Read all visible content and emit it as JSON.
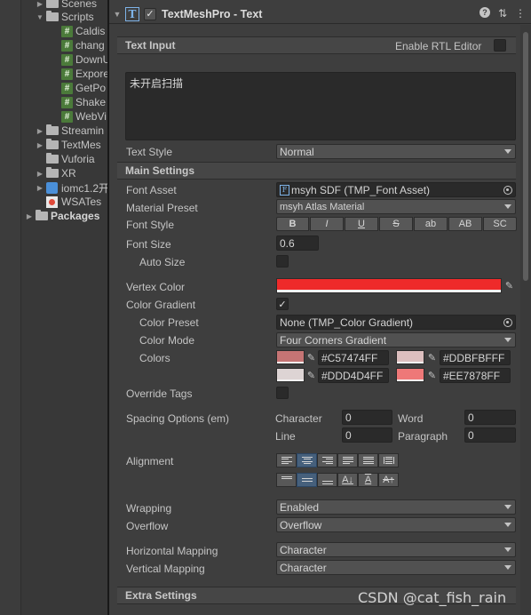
{
  "tree": {
    "items": [
      {
        "label": "Scenes",
        "kind": "folder",
        "arrow": "▶"
      },
      {
        "label": "Scripts",
        "kind": "folder",
        "arrow": "▼"
      },
      {
        "label": "Caldis",
        "kind": "script"
      },
      {
        "label": "chang",
        "kind": "script"
      },
      {
        "label": "DownU",
        "kind": "script"
      },
      {
        "label": "Expore",
        "kind": "script"
      },
      {
        "label": "GetPo",
        "kind": "script"
      },
      {
        "label": "Shake",
        "kind": "script"
      },
      {
        "label": "WebVi",
        "kind": "script"
      },
      {
        "label": "Streamin",
        "kind": "folder",
        "arrow": "▶"
      },
      {
        "label": "TextMes",
        "kind": "folder",
        "arrow": "▶"
      },
      {
        "label": "Vuforia",
        "kind": "folder"
      },
      {
        "label": "XR",
        "kind": "folder",
        "arrow": "▶"
      },
      {
        "label": "iomc1.2开",
        "kind": "package",
        "arrow": "▶"
      },
      {
        "label": "WSATes",
        "kind": "wsa"
      },
      {
        "label": "Packages",
        "kind": "folder",
        "arrow": "▶",
        "bold": true
      }
    ]
  },
  "component": {
    "title": "TextMeshPro - Text",
    "enabled": true,
    "icons": [
      "help-icon",
      "preset-icon",
      "more-icon"
    ]
  },
  "text_input": {
    "header": "Text Input",
    "rtl_label": "Enable RTL Editor",
    "rtl_enabled": false,
    "value": "未开启扫描"
  },
  "text_style": {
    "label": "Text Style",
    "value": "Normal"
  },
  "main_settings": {
    "header": "Main Settings",
    "font_asset": {
      "label": "Font Asset",
      "value": "msyh SDF (TMP_Font Asset)"
    },
    "material_preset": {
      "label": "Material Preset",
      "value": "msyh Atlas Material"
    },
    "font_style": {
      "label": "Font Style",
      "buttons": [
        "B",
        "I",
        "U",
        "S",
        "ab",
        "AB",
        "SC"
      ]
    },
    "font_size": {
      "label": "Font Size",
      "value": "0.6"
    },
    "auto_size": {
      "label": "Auto Size",
      "checked": false
    },
    "vertex_color": {
      "label": "Vertex Color",
      "color": "#EE2A2A"
    },
    "color_gradient": {
      "label": "Color Gradient",
      "checked": true
    },
    "color_preset": {
      "label": "Color Preset",
      "value": "None (TMP_Color Gradient)"
    },
    "color_mode": {
      "label": "Color Mode",
      "value": "Four Corners Gradient"
    },
    "colors": {
      "label": "Colors",
      "items": [
        {
          "hex": "#C57474FF",
          "color": "#C57474"
        },
        {
          "hex": "#DDBFBFFF",
          "color": "#DDBFBF"
        },
        {
          "hex": "#DDD4D4FF",
          "color": "#DDD4D4"
        },
        {
          "hex": "#EE7878FF",
          "color": "#EE7878"
        }
      ]
    },
    "override_tags": {
      "label": "Override Tags",
      "checked": false
    },
    "spacing": {
      "label": "Spacing Options (em)",
      "character_label": "Character",
      "character": "0",
      "word_label": "Word",
      "word": "0",
      "line_label": "Line",
      "line": "0",
      "paragraph_label": "Paragraph",
      "paragraph": "0"
    },
    "alignment": {
      "label": "Alignment",
      "horizontal_active": 1,
      "vertical_active": 1
    },
    "wrapping": {
      "label": "Wrapping",
      "value": "Enabled"
    },
    "overflow": {
      "label": "Overflow",
      "value": "Overflow"
    },
    "horizontal_mapping": {
      "label": "Horizontal Mapping",
      "value": "Character"
    },
    "vertical_mapping": {
      "label": "Vertical Mapping",
      "value": "Character"
    }
  },
  "extra_settings": {
    "header": "Extra Settings"
  },
  "watermark": "CSDN @cat_fish_rain"
}
